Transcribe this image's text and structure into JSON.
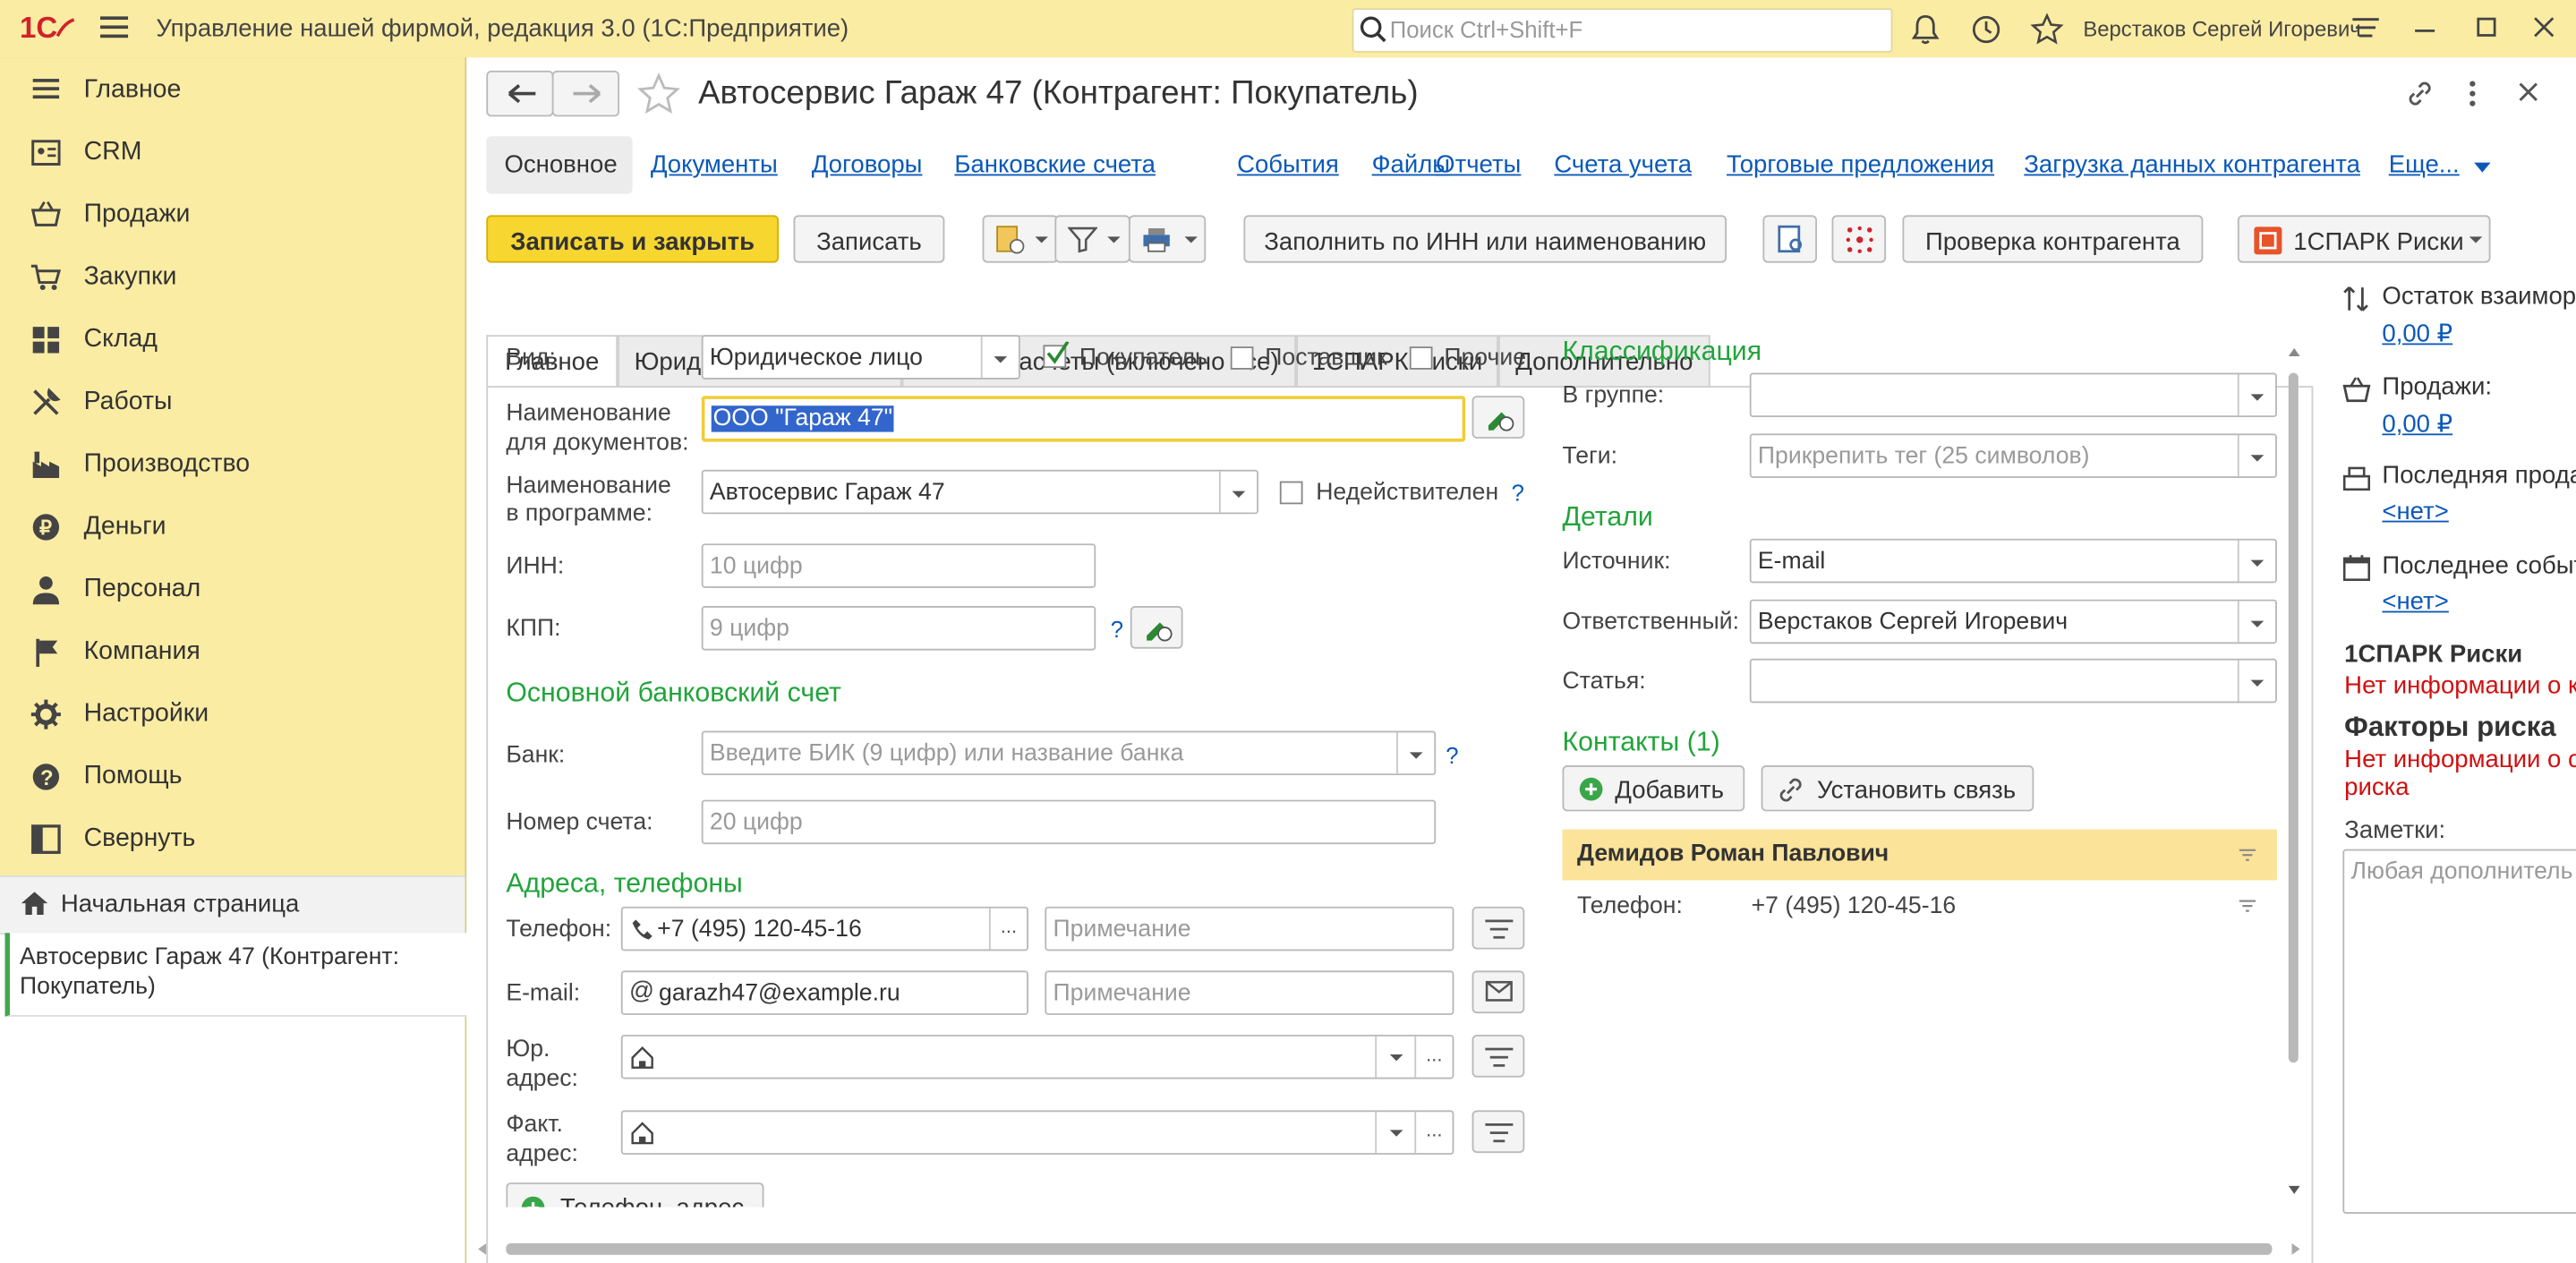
{
  "app": {
    "title": "Управление нашей фирмой, редакция 3.0  (1С:Предприятие)",
    "search_placeholder": "Поиск Ctrl+Shift+F",
    "user": "Верстаков Сергей Игоревич"
  },
  "sidebar": {
    "items": [
      {
        "label": "Главное",
        "icon": "list-icon"
      },
      {
        "label": "CRM",
        "icon": "crm-icon"
      },
      {
        "label": "Продажи",
        "icon": "basket-icon"
      },
      {
        "label": "Закупки",
        "icon": "cart-icon"
      },
      {
        "label": "Склад",
        "icon": "warehouse-icon"
      },
      {
        "label": "Работы",
        "icon": "tools-icon"
      },
      {
        "label": "Производство",
        "icon": "factory-icon"
      },
      {
        "label": "Деньги",
        "icon": "coin-icon"
      },
      {
        "label": "Персонал",
        "icon": "person-icon"
      },
      {
        "label": "Компания",
        "icon": "flag-icon"
      },
      {
        "label": "Настройки",
        "icon": "gear-icon"
      },
      {
        "label": "Помощь",
        "icon": "help-icon"
      },
      {
        "label": "Свернуть",
        "icon": "collapse-icon"
      }
    ],
    "home": "Начальная страница",
    "open_window": "Автосервис Гараж 47 (Контрагент: Покупатель)"
  },
  "form": {
    "title": "Автосервис Гараж 47 (Контрагент: Покупатель)",
    "sections": [
      "Основное",
      "Документы",
      "Договоры",
      "Банковские счета",
      "События",
      "Файлы",
      "Отчеты",
      "Счета учета",
      "Торговые предложения",
      "Загрузка данных контрагента",
      "Еще..."
    ],
    "toolbar": {
      "save_close": "Записать и закрыть",
      "save": "Записать",
      "fill_inn": "Заполнить по ИНН или наименованию",
      "check": "Проверка контрагента",
      "spark": "1СПАРК Риски"
    },
    "tabs": [
      "Главное",
      "Юридические данные",
      "Взаиморасчеты (включено все)",
      "1СПАРК Риски",
      "Дополнительно"
    ],
    "main": {
      "vid_label": "Вид:",
      "vid_value": "Юридическое лицо",
      "buyer": "Покупатель",
      "supplier": "Поставщик",
      "other": "Прочие",
      "name_docs_label1": "Наименование",
      "name_docs_label2": "для документов:",
      "name_docs_value": "ООО \"Гараж 47\"",
      "name_prog_label1": "Наименование",
      "name_prog_label2": "в программе:",
      "name_prog_value": "Автосервис Гараж 47",
      "invalid": "Недействителен",
      "inn_label": "ИНН:",
      "inn_placeholder": "10 цифр",
      "kpp_label": "КПП:",
      "kpp_placeholder": "9 цифр",
      "bank_section": "Основной банковский счет",
      "bank_label": "Банк:",
      "bank_placeholder": "Введите БИК (9 цифр) или название банка",
      "account_label": "Номер счета:",
      "account_placeholder": "20 цифр",
      "address_section": "Адреса, телефоны",
      "phone_label": "Телефон:",
      "phone_value": "+7 (495) 120-45-16",
      "note_placeholder": "Примечание",
      "email_label": "E-mail:",
      "email_value": "garazh47@example.ru",
      "legal_addr1": "Юр.",
      "legal_addr2": "адрес:",
      "fact_addr1": "Факт.",
      "fact_addr2": "адрес:",
      "add_phone_address": "Телефон, адрес",
      "q": "?"
    },
    "classification": {
      "title": "Классификация",
      "group_label": "В группе:",
      "tags_label": "Теги:",
      "tags_placeholder": "Прикрепить тег (25 символов)",
      "details_title": "Детали",
      "source_label": "Источник:",
      "source_value": "E-mail",
      "responsible_label": "Ответственный:",
      "responsible_value": "Верстаков Сергей Игоревич",
      "article_label": "Статья:",
      "contacts_title": "Контакты (1)",
      "add": "Добавить",
      "link": "Установить связь",
      "contact_name": "Демидов Роман Павлович",
      "contact_phone_label": "Телефон:",
      "contact_phone": "+7 (495) 120-45-16"
    },
    "right_panel": {
      "balance_label": "Остаток взаимор",
      "balance_value": "0,00 ₽",
      "sales_label": "Продажи:",
      "sales_value": "0,00 ₽",
      "last_sale_label": "Последняя прода",
      "last_sale_value": "<нет>",
      "last_event_label": "Последнее событ",
      "last_event_value": "<нет>",
      "spark_title": "1СПАРК Риски",
      "spark_info": "Нет информации о к",
      "risk_title": "Факторы риска",
      "risk_info1": "Нет информации о с",
      "risk_info2": "риска",
      "notes_label": "Заметки:",
      "notes_placeholder": "Любая дополнитель"
    }
  },
  "colors": {
    "accent_yellow": "#fbeca3",
    "primary_button": "#f7d630",
    "green_section": "#21a43b",
    "link": "#0b59b8",
    "error": "#d01010"
  }
}
